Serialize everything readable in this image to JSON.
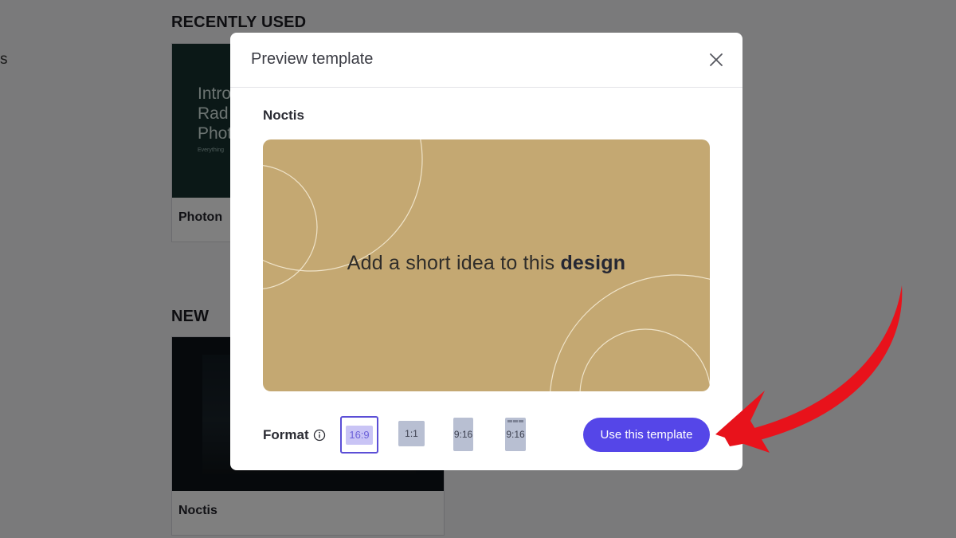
{
  "background": {
    "left_fragment": "s",
    "recently_used": {
      "title": "RECENTLY USED",
      "card": {
        "thumb_text": "Intro\nRad\nPhot",
        "thumb_small": "Everything",
        "label": "Photon"
      }
    },
    "new": {
      "title": "NEW",
      "card": {
        "label": "Noctis"
      }
    }
  },
  "modal": {
    "title": "Preview template",
    "template_name": "Noctis",
    "preview": {
      "text_plain": "Add a short idea to this ",
      "text_bold": "design",
      "background_color": "#c4a872"
    },
    "format": {
      "label": "Format",
      "info_icon": "info-icon",
      "options": [
        {
          "label": "16:9",
          "selected": true
        },
        {
          "label": "1:1",
          "selected": false
        },
        {
          "label": "9:16",
          "selected": false
        },
        {
          "label": "9:16",
          "selected": false
        }
      ]
    },
    "primary_button": "Use this template"
  },
  "colors": {
    "accent": "#5546e8",
    "annotation_arrow": "#e8121b"
  }
}
